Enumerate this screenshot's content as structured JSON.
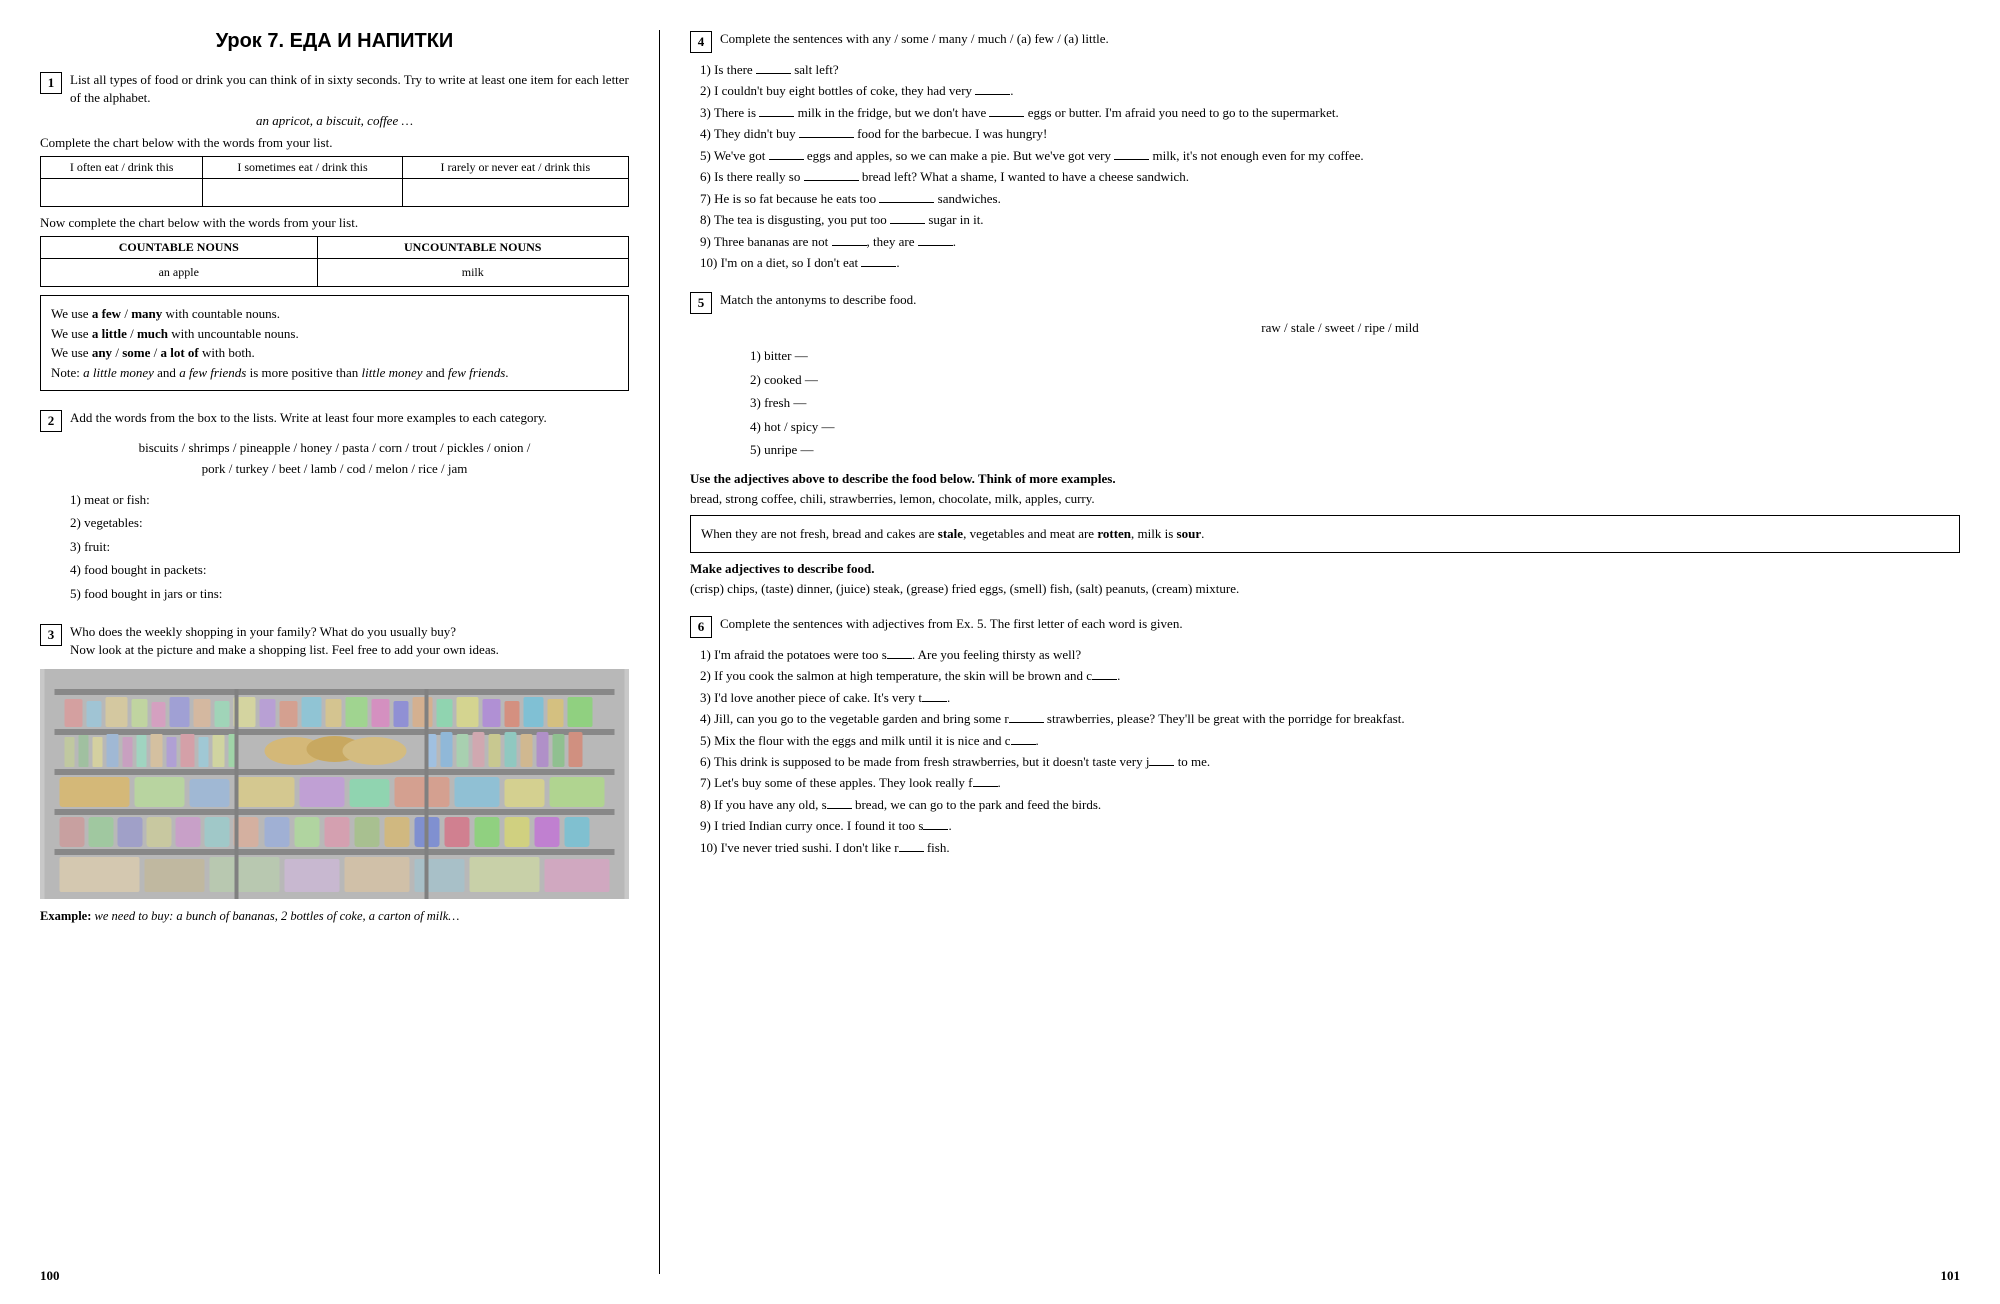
{
  "title": "Урок 7. ЕДА И НАПИТКИ",
  "left": {
    "ex1": {
      "number": "1",
      "instruction": "List all types of food or drink you can think of in sixty seconds. Try to write at least one item for each letter of the alphabet.",
      "example": "an apricot, a biscuit, coffee …",
      "chart1_instruction": "Complete the chart below with the words from your list.",
      "chart1_headers": [
        "I often eat / drink this",
        "I sometimes eat / drink this",
        "I rarely or never eat / drink this"
      ],
      "chart2_instruction": "Now complete the chart below with the words from your list.",
      "chart2_headers": [
        "COUNTABLE NOUNS",
        "UNCOUNTABLE NOUNS"
      ],
      "chart2_rows": [
        [
          "an apple",
          "milk"
        ]
      ],
      "grammar": [
        "We use <b>a few</b> / <b>many</b> with countable nouns.",
        "We use <b>a little</b> / <b>much</b> with uncountable nouns.",
        "We use <b>any</b> / <b>some</b> / <b>a lot of</b> with both.",
        "Note: <i>a little money</i> and <i>a few friends</i> is more positive than <i>little money</i> and <i>few friends</i>."
      ]
    },
    "ex2": {
      "number": "2",
      "instruction": "Add the words from the box to the lists. Write at least four more examples to each category.",
      "word_list": "biscuits / shrimps / pineapple / honey / pasta / corn / trout / pickles / onion /\npork / turkey / beet / lamb / cod / melon / rice / jam",
      "categories": [
        "1) meat or fish:",
        "2) vegetables:",
        "3) fruit:",
        "4) food bought in packets:",
        "5) food bought in jars or tins:"
      ]
    },
    "ex3": {
      "number": "3",
      "instruction": "Who does the weekly shopping in your family? What do you usually buy?\nNow look at the picture and make a shopping list. Feel free to add your own ideas.",
      "caption_bold": "Example:",
      "caption_italic": " we need to buy: a bunch of bananas, 2 bottles of coke, a carton of milk…"
    }
  },
  "right": {
    "ex4": {
      "number": "4",
      "instruction": "Complete the sentences with any / some / many / much / (a) few / (a) little.",
      "sentences": [
        "1) Is there <blank/> salt left?",
        "2) I couldn't buy eight bottles of coke, they had very <blank/>.",
        "3) There is <blank/> milk in the fridge, but we don't have <blank/> eggs or butter. I'm afraid you need to go to the supermarket.",
        "4) They didn't buy <blank/> food for the barbecue. I was hungry!",
        "5) We've got <blank/> eggs and apples, so we can make a pie. But we've got very <blank/> milk, it's not enough even for my coffee.",
        "6) Is there really so <blank/> bread left? What a shame, I wanted to have a cheese sandwich.",
        "7) He is so fat because he eats too <blank/> sandwiches.",
        "8) The tea is disgusting, you put too <blank/> sugar in it.",
        "9) Three bananas are not <blank/>, they are <blank/>.",
        "10) I'm on a diet, so I don't eat <blank/>."
      ]
    },
    "ex5": {
      "number": "5",
      "instruction": "Match the antonyms to describe food.",
      "antonyms_words": "raw / stale / sweet / ripe / mild",
      "antonyms_list": [
        "1) bitter —",
        "2) cooked —",
        "3) fresh —",
        "4) hot / spicy —",
        "5) unripe —"
      ],
      "adjectives_instruction": "Use the adjectives above to describe the food below. Think of more examples.",
      "adjectives_examples": "bread, strong coffee, chili, strawberries, lemon, chocolate, milk, apples, curry.",
      "stale_box": "When they are not fresh, bread and cakes are <b>stale</b>, vegetables and meat are <b>rotten</b>, milk is <b>sour</b>.",
      "make_instruction": "Make adjectives to describe food.",
      "make_examples": "(crisp) chips, (taste) dinner, (juice) steak, (grease) fried eggs, (smell) fish, (salt) peanuts, (cream) mixture."
    },
    "ex6": {
      "number": "6",
      "instruction": "Complete the sentences with adjectives from Ex. 5. The first letter of each word is given.",
      "sentences": [
        "1) I'm afraid the potatoes were too s___. Are you feeling thirsty as well?",
        "2) If you cook the salmon at high temperature, the skin will be brown and c___.",
        "3) I'd love another piece of cake. It's very t___.",
        "4) Jill, can you go to the vegetable garden and bring some r___ strawberries, please? They'll be great with the porridge for breakfast.",
        "5) Mix the flour with the eggs and milk until it is nice and c___.",
        "6) This drink is supposed to be made from fresh strawberries, but it doesn't taste very j___ to me.",
        "7) Let's buy some of these apples. They look really f___.",
        "8) If you have any old, s___ bread, we can go to the park and feed the birds.",
        "9) I tried Indian curry once. I found it too s___.",
        "10) I've never tried sushi. I don't like r___ fish."
      ]
    }
  },
  "page_numbers": {
    "left": "100",
    "right": "101"
  }
}
